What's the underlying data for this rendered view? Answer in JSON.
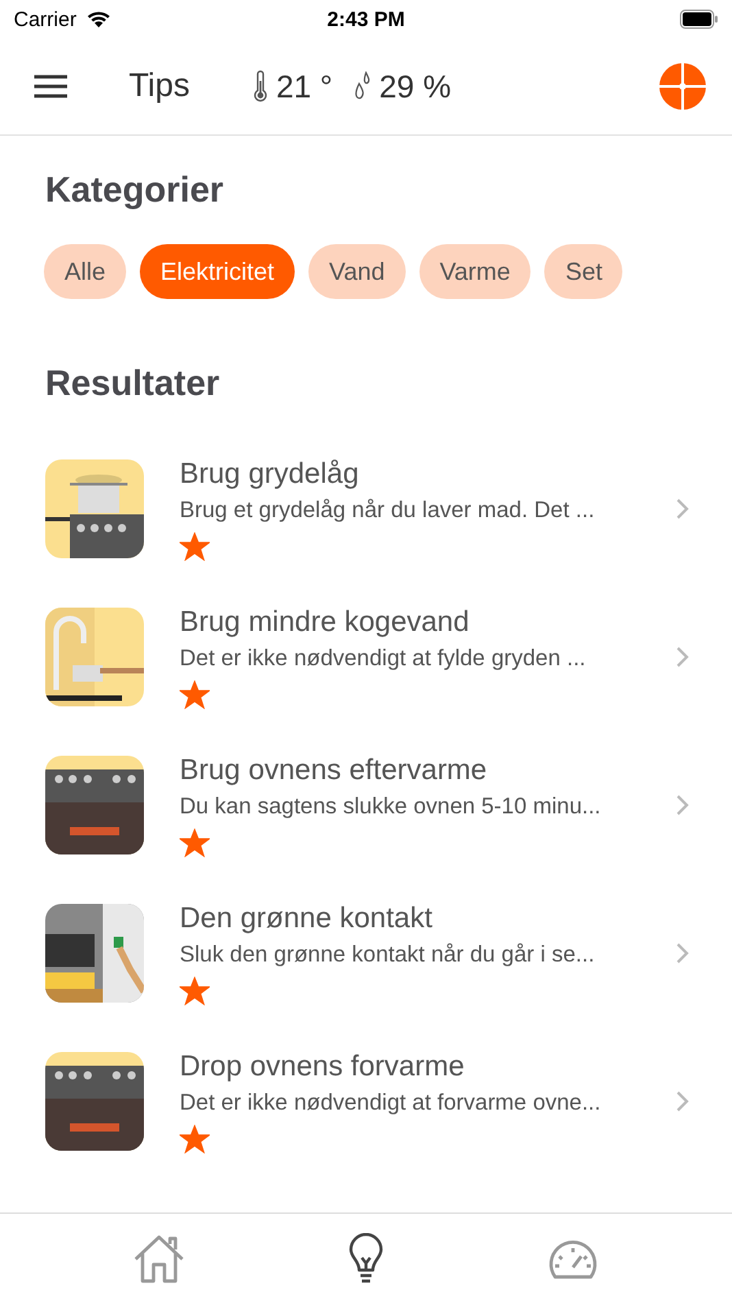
{
  "status_bar": {
    "carrier": "Carrier",
    "time": "2:43 PM"
  },
  "header": {
    "title": "Tips",
    "temperature": "21 °",
    "humidity": "29 %"
  },
  "categories": {
    "title": "Kategorier",
    "chips": [
      {
        "label": "Alle",
        "selected": false
      },
      {
        "label": "Elektricitet",
        "selected": true
      },
      {
        "label": "Vand",
        "selected": false
      },
      {
        "label": "Varme",
        "selected": false
      },
      {
        "label": "Set",
        "selected": false
      }
    ]
  },
  "results": {
    "title": "Resultater",
    "items": [
      {
        "title": "Brug grydelåg",
        "description": "Brug et grydelåg når du laver mad. Det ...",
        "starred": true,
        "kind": "picture"
      },
      {
        "title": "Brug mindre kogevand",
        "description": "Det er ikke nødvendigt at fylde gryden ...",
        "starred": true,
        "kind": "picture"
      },
      {
        "title": "Brug ovnens eftervarme",
        "description": "Du kan sagtens slukke ovnen 5-10 minu...",
        "starred": true,
        "kind": "picture"
      },
      {
        "title": "Den grønne kontakt",
        "description": "Sluk den grønne kontakt når du går i se...",
        "starred": true,
        "kind": "picture"
      },
      {
        "title": "Drop ovnens forvarme",
        "description": "Det er ikke nødvendigt at forvarme ovne...",
        "starred": true,
        "kind": "picture"
      }
    ]
  },
  "tab_bar": [
    {
      "kind": "home",
      "selected": false
    },
    {
      "kind": "tips",
      "selected": true
    },
    {
      "kind": "meter",
      "selected": false
    }
  ]
}
